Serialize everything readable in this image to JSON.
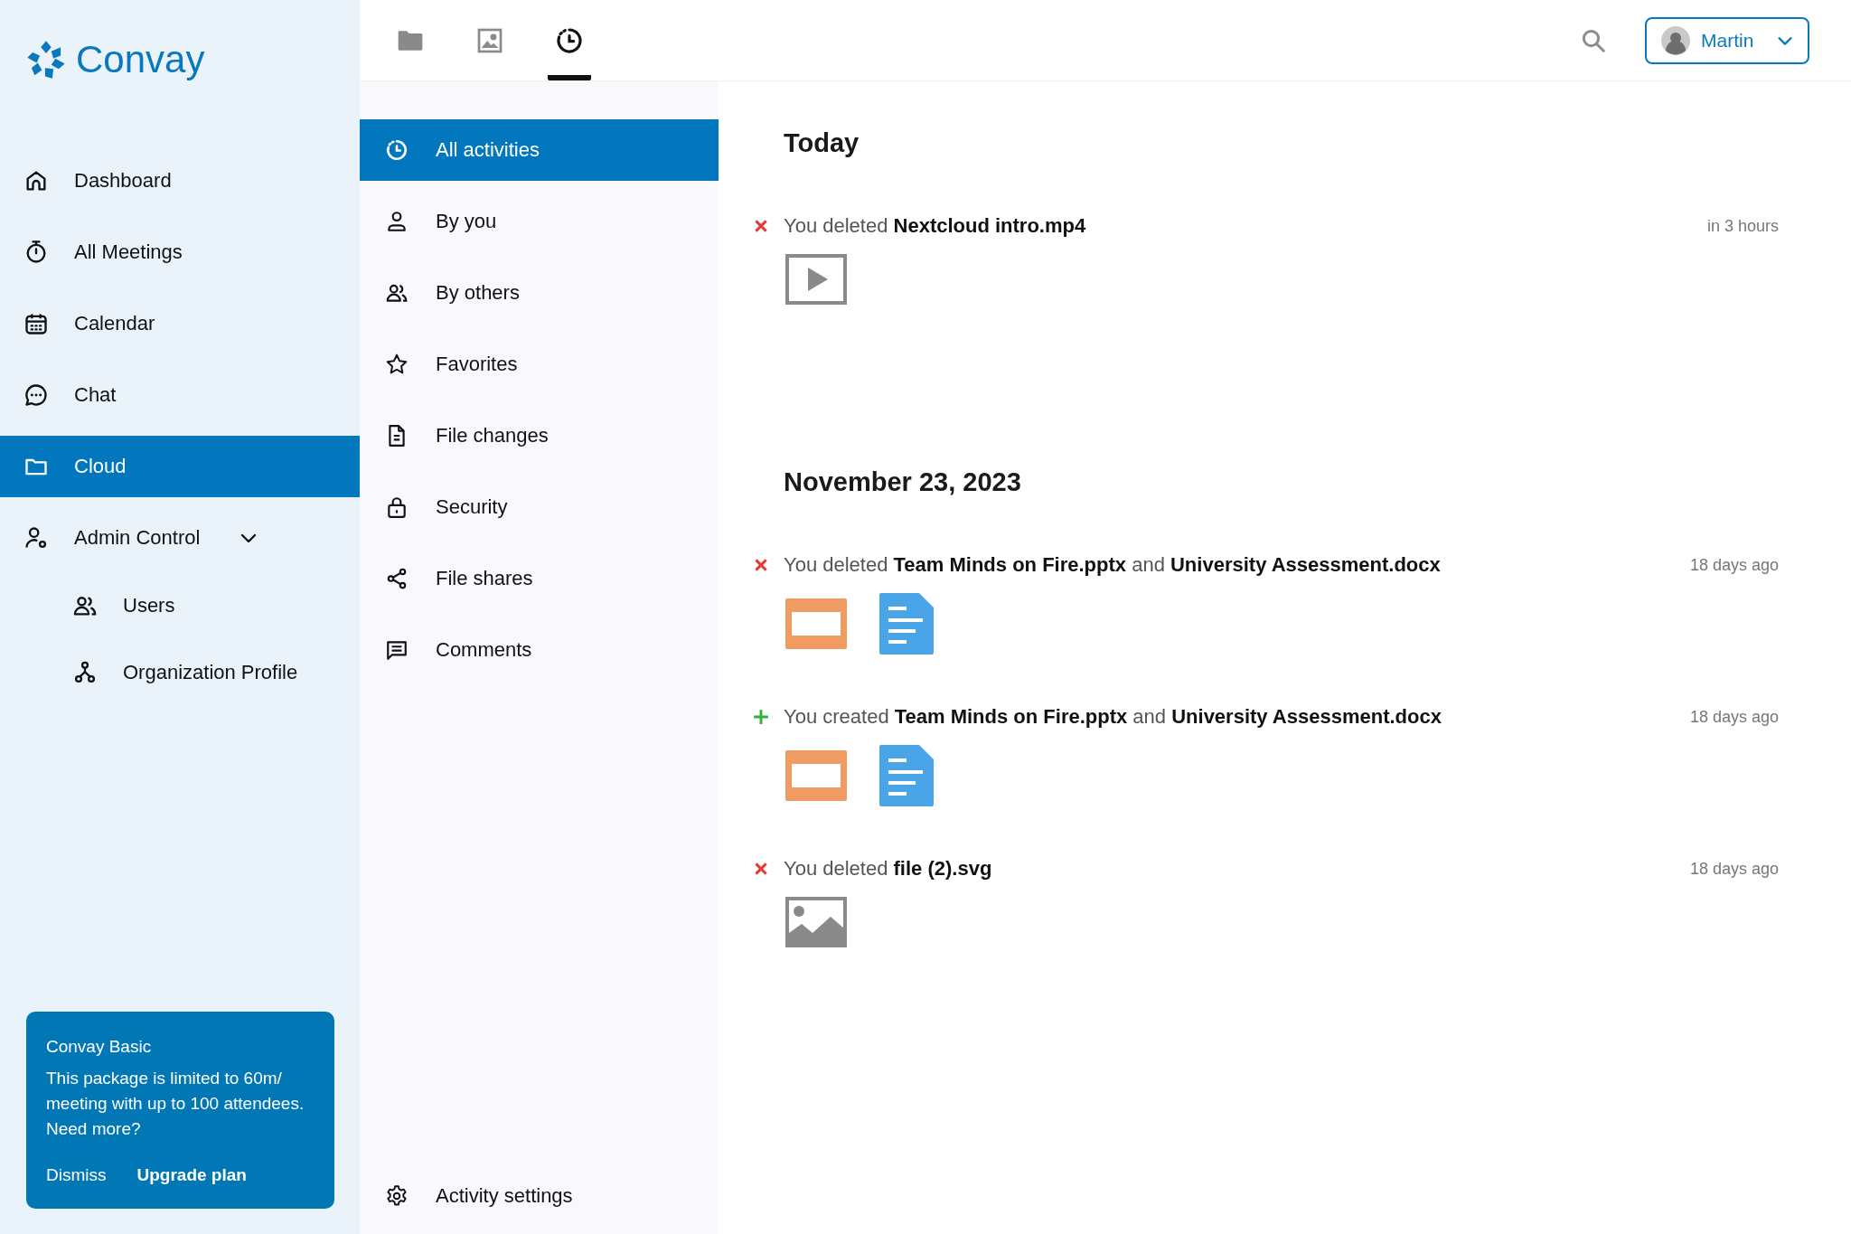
{
  "brand": {
    "name": "Convay"
  },
  "sidebar": {
    "items": [
      {
        "label": "Dashboard",
        "selected": false
      },
      {
        "label": "All Meetings",
        "selected": false
      },
      {
        "label": "Calendar",
        "selected": false
      },
      {
        "label": "Chat",
        "selected": false
      },
      {
        "label": "Cloud",
        "selected": true
      },
      {
        "label": "Admin Control",
        "selected": false,
        "expanded": true,
        "children": [
          {
            "label": "Users",
            "selected": false
          },
          {
            "label": "Organization Profile",
            "selected": false
          }
        ]
      }
    ]
  },
  "promo": {
    "title": "Convay Basic",
    "text": "This package is limited to 60m/ meeting with up to 100 attendees. Need more?",
    "actions": [
      "Dismiss",
      "Upgrade plan"
    ]
  },
  "top_tabs": [
    {
      "selected": false
    },
    {
      "selected": false
    },
    {
      "selected": true
    }
  ],
  "user": {
    "name": "Martin"
  },
  "filters": {
    "items": [
      {
        "label": "All activities",
        "selected": true
      },
      {
        "label": "By you",
        "selected": false
      },
      {
        "label": "By others",
        "selected": false
      },
      {
        "label": "Favorites",
        "selected": false
      },
      {
        "label": "File changes",
        "selected": false
      },
      {
        "label": "Security",
        "selected": false
      },
      {
        "label": "File shares",
        "selected": false
      },
      {
        "label": "Comments",
        "selected": false
      }
    ],
    "settings": "Activity settings"
  },
  "groups": [
    {
      "heading": "Today",
      "activities": [
        {
          "kind": "deleted",
          "text": "You deleted **Nextcloud intro.mp4**",
          "time": "in 3 hours",
          "files": [
            {
              "kind": "video"
            }
          ]
        }
      ]
    },
    {
      "heading": "November 23, 2023",
      "activities": [
        {
          "kind": "deleted",
          "text": "You deleted **Team Minds on Fire.pptx** and **University Assessment.docx**",
          "time": "18 days ago",
          "files": [
            {
              "kind": "presentation"
            },
            {
              "kind": "document"
            }
          ]
        },
        {
          "kind": "created",
          "text": "You created **Team Minds on Fire.pptx** and **University Assessment.docx**",
          "time": "18 days ago",
          "files": [
            {
              "kind": "presentation"
            },
            {
              "kind": "document"
            }
          ]
        },
        {
          "kind": "deleted",
          "text": "You deleted **file (2).svg**",
          "time": "18 days ago",
          "files": [
            {
              "kind": "image"
            }
          ]
        }
      ]
    }
  ]
}
